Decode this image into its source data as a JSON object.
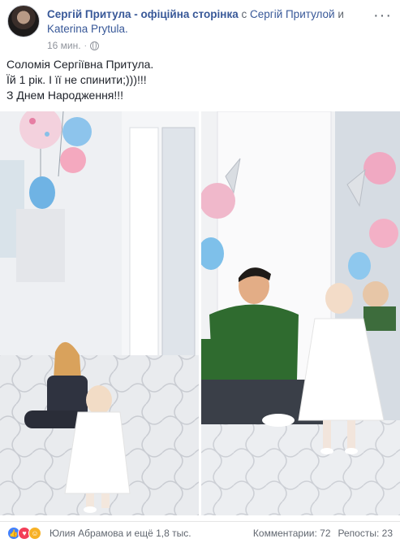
{
  "post": {
    "author": "Сергій Притула - офіційна сторінка",
    "with_word": "с",
    "tagged_1": "Сергій Притулой",
    "and_word": "и",
    "tagged_2": "Katerina Prytula.",
    "time": "16 мин.",
    "dot": "·",
    "text_lines": [
      "Соломія Сергіївна Притула.",
      "Їй 1 рік. І її не спинити;)))!!!",
      "З Днем Народження!!!"
    ]
  },
  "reactions": {
    "icons": [
      "like-icon",
      "love-icon",
      "haha-icon"
    ],
    "reactors_text": "Юлия Абрамова и ещё 1,8 тыс.",
    "comments": "Комментарии: 72",
    "shares": "Репосты: 23"
  },
  "colors": {
    "link": "#385898",
    "muted": "#90949c",
    "like": "#4080ff",
    "love": "#f33e58",
    "haha": "#f7b125"
  }
}
